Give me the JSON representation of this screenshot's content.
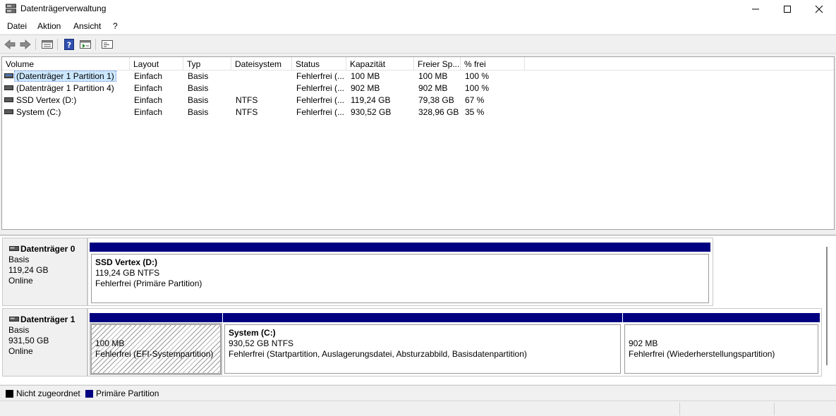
{
  "window": {
    "title": "Datenträgerverwaltung"
  },
  "menu": [
    {
      "label": "Datei"
    },
    {
      "label": "Aktion"
    },
    {
      "label": "Ansicht"
    },
    {
      "label": "?"
    }
  ],
  "toolbar": [
    "back-icon",
    "forward-icon",
    "disk-list-icon",
    "help-icon",
    "properties-icon",
    "console-icon"
  ],
  "volume_list": {
    "columns": [
      "Volume",
      "Layout",
      "Typ",
      "Dateisystem",
      "Status",
      "Kapazität",
      "Freier Sp...",
      "% frei"
    ],
    "rows": [
      {
        "volume": "(Datenträger 1 Partition 1)",
        "layout": "Einfach",
        "type": "Basis",
        "fs": "",
        "status": "Fehlerfrei (...",
        "capacity": "100 MB",
        "free": "100 MB",
        "pct": "100 %",
        "selected": true
      },
      {
        "volume": "(Datenträger 1 Partition 4)",
        "layout": "Einfach",
        "type": "Basis",
        "fs": "",
        "status": "Fehlerfrei (...",
        "capacity": "902 MB",
        "free": "902 MB",
        "pct": "100 %"
      },
      {
        "volume": "SSD Vertex (D:)",
        "layout": "Einfach",
        "type": "Basis",
        "fs": "NTFS",
        "status": "Fehlerfrei (...",
        "capacity": "119,24 GB",
        "free": "79,38 GB",
        "pct": "67 %"
      },
      {
        "volume": "System (C:)",
        "layout": "Einfach",
        "type": "Basis",
        "fs": "NTFS",
        "status": "Fehlerfrei (...",
        "capacity": "930,52 GB",
        "free": "328,96 GB",
        "pct": "35 %"
      }
    ]
  },
  "disks": [
    {
      "name": "Datenträger 0",
      "type": "Basis",
      "size": "119,24 GB",
      "state": "Online",
      "partitions": [
        {
          "name": "SSD Vertex  (D:)",
          "size": "119,24 GB NTFS",
          "status": "Fehlerfrei (Primäre Partition)"
        }
      ]
    },
    {
      "name": "Datenträger 1",
      "type": "Basis",
      "size": "931,50 GB",
      "state": "Online",
      "partitions": [
        {
          "name": "",
          "size": "100 MB",
          "status": "Fehlerfrei (EFI-Systempartition)"
        },
        {
          "name": "System  (C:)",
          "size": "930,52 GB NTFS",
          "status": "Fehlerfrei (Startpartition, Auslagerungsdatei, Absturzabbild, Basisdatenpartition)"
        },
        {
          "name": "",
          "size": "902 MB",
          "status": "Fehlerfrei (Wiederherstellungspartition)"
        }
      ]
    }
  ],
  "legend": [
    {
      "label": "Nicht zugeordnet",
      "color": "#000000"
    },
    {
      "label": "Primäre Partition",
      "color": "#000080"
    }
  ]
}
